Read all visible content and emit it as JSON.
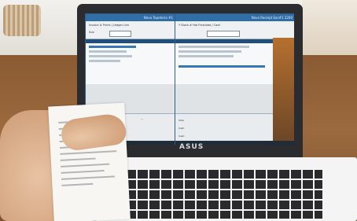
{
  "scene": {
    "laptop_brand": "ASUS",
    "left_window": {
      "title": "Nova Tapeteria #1",
      "toolbar_line1": "Invoice # Prints | Ledger Link",
      "toolbar_line2": "Sub",
      "rows_selected_index": 0
    },
    "right_window": {
      "title": "Nova Receipt Eac#1 2200",
      "toolbar_line1": "Y Stock #   Fab   Flexidata / Cash",
      "bottom_label_1": "Total",
      "bottom_label_2": "Cash",
      "bottom_label_3": "Cash"
    }
  }
}
